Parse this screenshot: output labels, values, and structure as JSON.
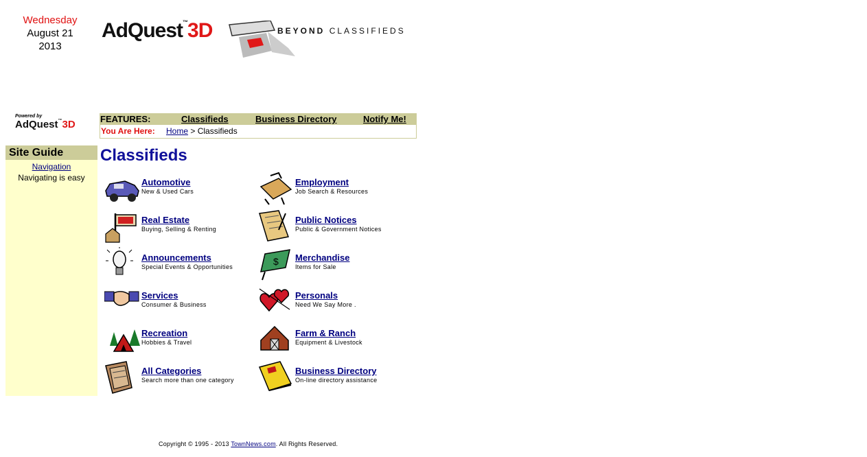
{
  "date": {
    "weekday": "Wednesday",
    "monthday": "August 21",
    "year": "2013"
  },
  "logo": {
    "brand": "AdQuest",
    "brand_3d": "3D",
    "tm": "™",
    "tagline_bold": "BEYOND",
    "tagline_light": "CLASSIFIEDS"
  },
  "powered": {
    "label": "Powered by",
    "brand": "AdQuest",
    "brand_3d": "3D",
    "tm": "™"
  },
  "features": {
    "label": "FEATURES:",
    "classifieds": "Classifieds",
    "business_directory": "Business Directory",
    "notify": "Notify Me!"
  },
  "breadcrumb": {
    "label": "You Are Here:",
    "home": "Home",
    "separator": " > ",
    "current": "Classifieds"
  },
  "site_guide": {
    "title": "Site Guide",
    "nav_link": "Navigation",
    "description": "Navigating is easy"
  },
  "page_title": "Classifieds",
  "categories": [
    {
      "name": "Automotive",
      "sub": "New & Used Cars",
      "icon": "car-icon"
    },
    {
      "name": "Employment",
      "sub": "Job Search & Resources",
      "icon": "briefcase-icon"
    },
    {
      "name": "Real Estate",
      "sub": "Buying, Selling & Renting",
      "icon": "sold-sign-icon"
    },
    {
      "name": "Public Notices",
      "sub": "Public & Government Notices",
      "icon": "scroll-icon"
    },
    {
      "name": "Announcements",
      "sub": "Special Events & Opportunities",
      "icon": "lightbulb-icon"
    },
    {
      "name": "Merchandise",
      "sub": "Items for Sale",
      "icon": "money-tag-icon"
    },
    {
      "name": "Services",
      "sub": "Consumer & Business",
      "icon": "handshake-icon"
    },
    {
      "name": "Personals",
      "sub": "Need We Say More .",
      "icon": "hearts-icon"
    },
    {
      "name": "Recreation",
      "sub": "Hobbies & Travel",
      "icon": "tent-icon"
    },
    {
      "name": "Farm & Ranch",
      "sub": "Equipment & Livestock",
      "icon": "barn-icon"
    },
    {
      "name": "All Categories",
      "sub": "Search more than one category",
      "icon": "newspapers-icon"
    },
    {
      "name": "Business Directory",
      "sub": "On-line directory assistance",
      "icon": "phonebook-icon"
    }
  ],
  "footer": {
    "prefix": "Copyright © 1995 - 2013 ",
    "link": "TownNews.com",
    "suffix": ". All Rights Reserved."
  }
}
